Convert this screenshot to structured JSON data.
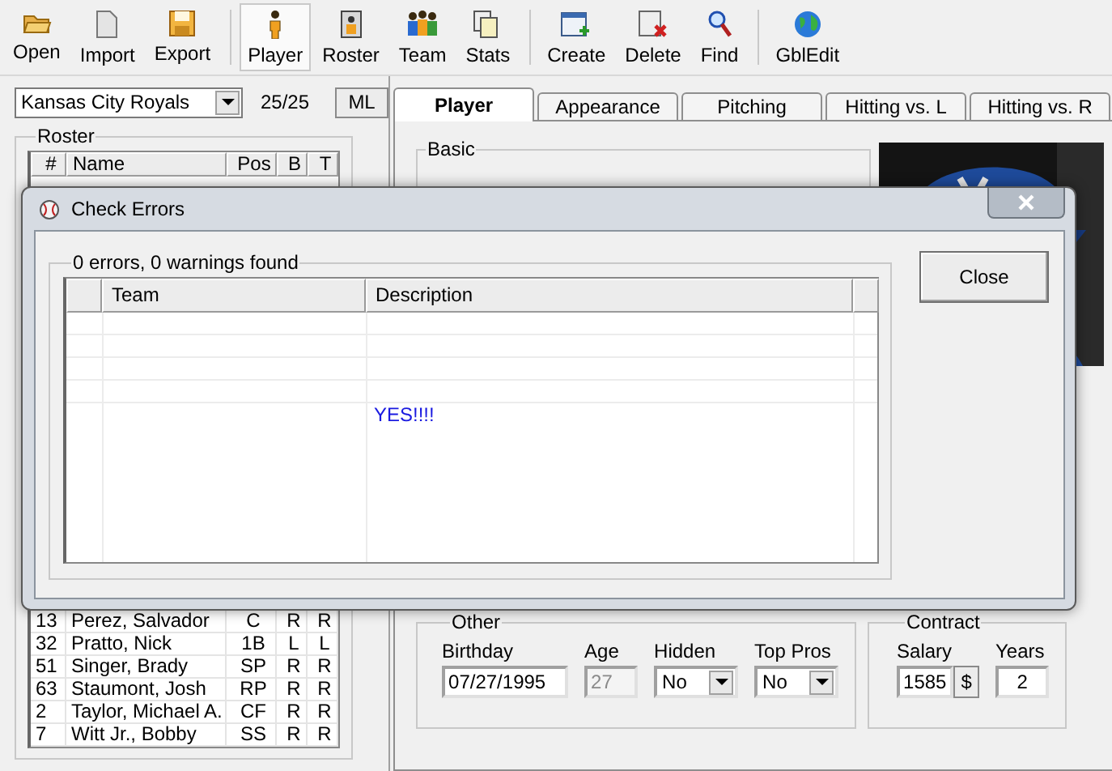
{
  "toolbar": {
    "groups": [
      {
        "items": [
          {
            "label": "Open",
            "selected": false
          },
          {
            "label": "Import",
            "selected": false
          },
          {
            "label": "Export",
            "selected": false
          }
        ]
      },
      {
        "items": [
          {
            "label": "Player",
            "selected": true
          },
          {
            "label": "Roster",
            "selected": false
          },
          {
            "label": "Team",
            "selected": false
          },
          {
            "label": "Stats",
            "selected": false
          }
        ]
      },
      {
        "items": [
          {
            "label": "Create",
            "selected": false
          },
          {
            "label": "Delete",
            "selected": false
          },
          {
            "label": "Find",
            "selected": false
          }
        ]
      },
      {
        "items": [
          {
            "label": "GblEdit",
            "selected": false
          }
        ]
      }
    ]
  },
  "team_select": {
    "value": "Kansas City Royals"
  },
  "roster_count": "25/25",
  "ml_button": "ML",
  "roster": {
    "title": "Roster",
    "columns": [
      "#",
      "Name",
      "Pos",
      "B",
      "T"
    ],
    "rows": [
      [
        "13",
        "Perez, Salvador",
        "C",
        "R",
        "R"
      ],
      [
        "32",
        "Pratto, Nick",
        "1B",
        "L",
        "L"
      ],
      [
        "51",
        "Singer, Brady",
        "SP",
        "R",
        "R"
      ],
      [
        "63",
        "Staumont, Josh",
        "RP",
        "R",
        "R"
      ],
      [
        "2",
        "Taylor, Michael A.",
        "CF",
        "R",
        "R"
      ],
      [
        "7",
        "Witt Jr., Bobby",
        "SS",
        "R",
        "R"
      ]
    ]
  },
  "tabs": [
    {
      "label": "Player",
      "selected": true
    },
    {
      "label": "Appearance",
      "selected": false
    },
    {
      "label": "Pitching",
      "selected": false
    },
    {
      "label": "Hitting vs. L",
      "selected": false
    },
    {
      "label": "Hitting vs. R",
      "selected": false
    }
  ],
  "basic": {
    "title": "Basic"
  },
  "other": {
    "title": "Other",
    "birthday": {
      "label": "Birthday",
      "value": "07/27/1995"
    },
    "age": {
      "label": "Age",
      "value": "27",
      "disabled": true
    },
    "hidden": {
      "label": "Hidden",
      "value": "No"
    },
    "top_pros": {
      "label": "Top Pros",
      "value": "No"
    }
  },
  "contract": {
    "title": "Contract",
    "salary": {
      "label": "Salary",
      "value": "1585",
      "unit": "$"
    },
    "years": {
      "label": "Years",
      "value": "2"
    }
  },
  "dialog": {
    "title": "Check Errors",
    "summary": "0 errors, 0 warnings found",
    "columns": [
      "Team",
      "Description"
    ],
    "message": "YES!!!!",
    "close_button": "Close"
  }
}
